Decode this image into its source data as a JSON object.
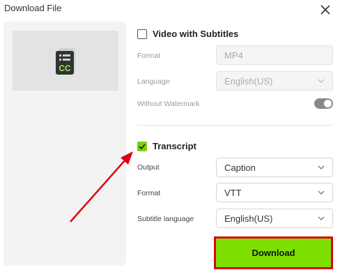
{
  "dialog": {
    "title": "Download File"
  },
  "preview": {
    "badge_text": "CC"
  },
  "video_section": {
    "label": "Video with Subtitles",
    "checked": false,
    "format_label": "Format",
    "format_value": "MP4",
    "language_label": "Language",
    "language_value": "English(US)",
    "watermark_label": "Without Watermark",
    "watermark_on": true
  },
  "transcript_section": {
    "label": "Transcript",
    "checked": true,
    "output_label": "Output",
    "output_value": "Caption",
    "format_label": "Format",
    "format_value": "VTT",
    "subtitle_language_label": "Subtitle language",
    "subtitle_language_value": "English(US)"
  },
  "download_button": {
    "label": "Download"
  },
  "colors": {
    "accent_green": "#7ee000",
    "highlight_red": "#e0000f"
  }
}
